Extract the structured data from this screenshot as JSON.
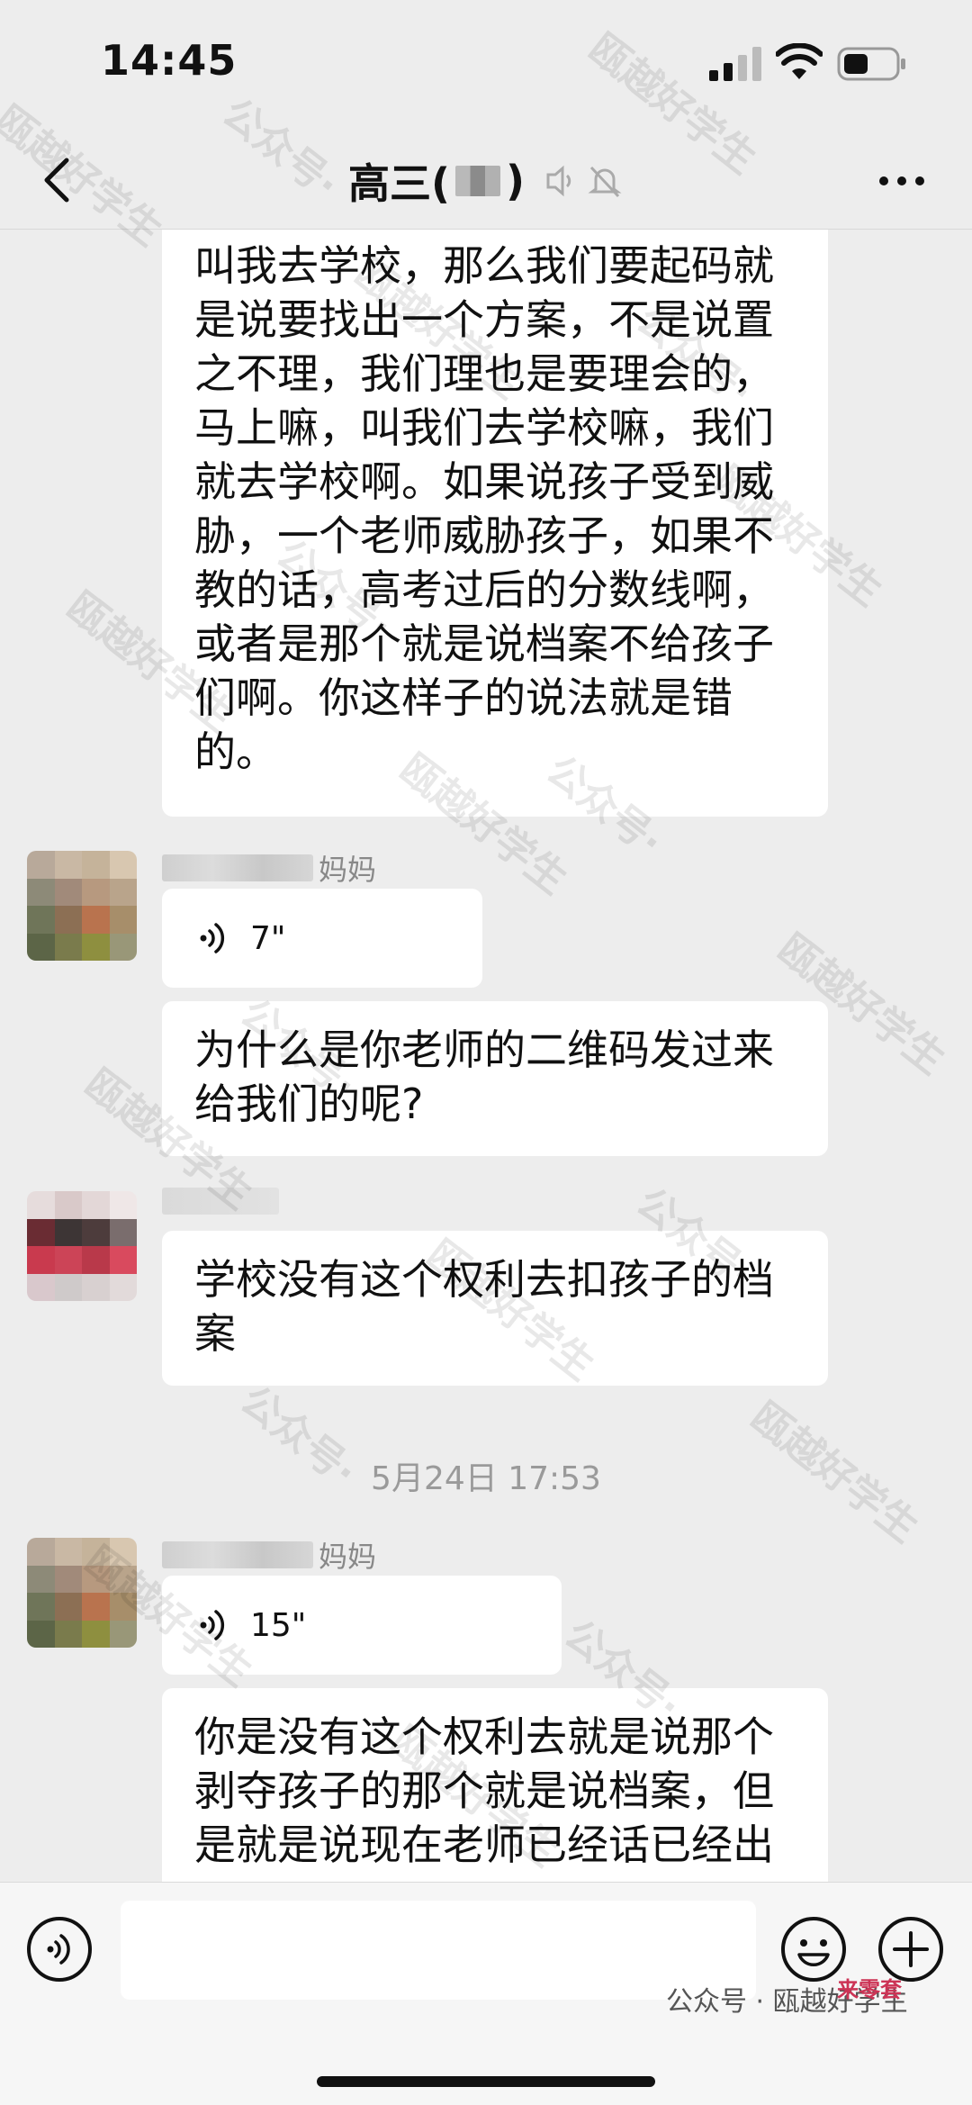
{
  "status_bar": {
    "time": "14:45"
  },
  "nav": {
    "title_prefix": "高三(",
    "title_suffix": ")"
  },
  "messages": {
    "m1_text": "叫我去学校，那么我们要起码就是说要找出一个方案，不是说置之不理，我们理也是要理会的，马上嘛，叫我们去学校嘛，我们就去学校啊。如果说孩子受到威胁，一个老师威胁孩子，如果不教的话，高考过后的分数线啊，或者是那个就是说档案不给孩子们啊。你这样子的说法就是错的。",
    "sender_mama_suffix": "妈妈",
    "voice1_duration": "7\"",
    "m2_text": "为什么是你老师的二维码发过来给我们的呢?",
    "m3_text": "学校没有这个权利去扣孩子的档案",
    "timestamp": "5月24日 17:53",
    "voice2_duration": "15\"",
    "m4_text": "你是没有这个权利去就是说那个剥夺孩子的那个就是说档案，但是就是说现在老师已经话已经出"
  },
  "watermark": {
    "text": "瓯越好学生",
    "prefix": "公众号·"
  },
  "footer": {
    "text": "公众号 · 瓯越好学生",
    "logo": "来零套"
  },
  "colors": {
    "background": "#ededed",
    "bubble": "#ffffff",
    "muted": "#888888"
  }
}
